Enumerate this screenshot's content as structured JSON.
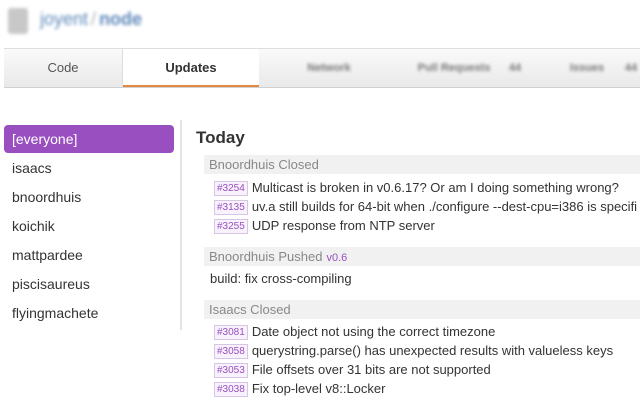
{
  "header": {
    "owner": "joyent",
    "separator": "/",
    "repo": "node"
  },
  "tabs": {
    "code": "Code",
    "updates": "Updates",
    "network": "Network",
    "pull_requests": "Pull Requests",
    "pull_requests_count": "44",
    "issues": "Issues",
    "issues_count": "44"
  },
  "sidebar": {
    "items": [
      "[everyone]",
      "isaacs",
      "bnoordhuis",
      "koichik",
      "mattpardee",
      "piscisaureus",
      "flyingmachete"
    ]
  },
  "feed": {
    "day": "Today",
    "groups": [
      {
        "heading": "Bnoordhuis Closed",
        "items": [
          {
            "num": "#3254",
            "text": "Multicast is broken in v0.6.17? Or am I doing something wrong?"
          },
          {
            "num": "#3135",
            "text": "uv.a still builds for 64-bit when ./configure --dest-cpu=i386 is specifi"
          },
          {
            "num": "#3255",
            "text": "UDP response from NTP server"
          }
        ]
      },
      {
        "heading": "Bnoordhuis Pushed",
        "ref": "v0.6",
        "items": [
          {
            "text": "build: fix cross-compiling"
          }
        ]
      },
      {
        "heading": "Isaacs Closed",
        "items": [
          {
            "num": "#3081",
            "text": "Date object not using the correct timezone"
          },
          {
            "num": "#3058",
            "text": "querystring.parse() has unexpected results with valueless keys"
          },
          {
            "num": "#3053",
            "text": "File offsets over 31 bits are not supported"
          },
          {
            "num": "#3038",
            "text": "Fix top-level v8::Locker"
          }
        ]
      }
    ]
  },
  "colors": {
    "accent": "#9a4fc0",
    "tab_underline": "#e28a44",
    "link": "#5f89ba"
  }
}
